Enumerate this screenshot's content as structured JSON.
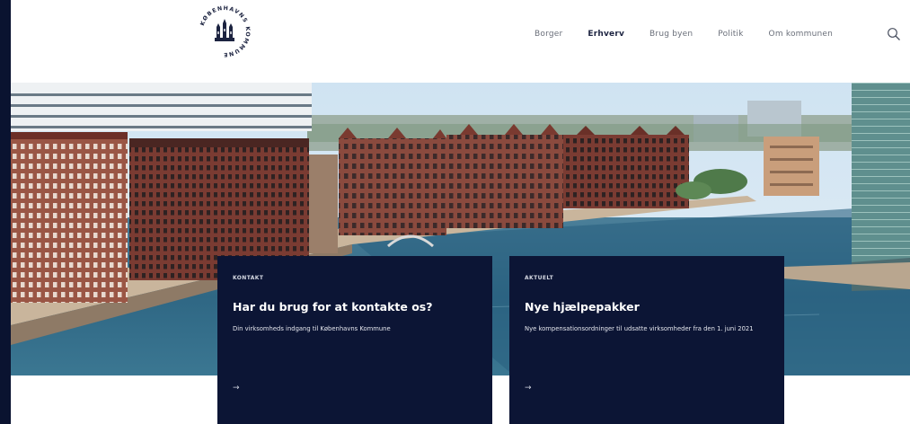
{
  "header": {
    "logo_text": "KØBENHAVNS KOMMUNE",
    "nav": [
      {
        "label": "Borger",
        "active": false
      },
      {
        "label": "Erhverv",
        "active": true
      },
      {
        "label": "Brug byen",
        "active": false
      },
      {
        "label": "Politik",
        "active": false
      },
      {
        "label": "Om kommunen",
        "active": false
      }
    ],
    "search_icon": "search-icon"
  },
  "cards": [
    {
      "kicker": "KONTAKT",
      "title": "Har du brug for at kontakte os?",
      "description": "Din virksomheds indgang til Københavns Kommune",
      "arrow": "→"
    },
    {
      "kicker": "AKTUELT",
      "title": "Nye hjælpepakker",
      "description": "Nye kompensationsordninger til udsatte virksomheder fra den 1. juni 2021",
      "arrow": "→"
    }
  ],
  "colors": {
    "frame": "#0a1330",
    "card_bg": "#0c1535",
    "nav_active": "#1c2340",
    "nav_inactive": "#6a6f7a"
  }
}
